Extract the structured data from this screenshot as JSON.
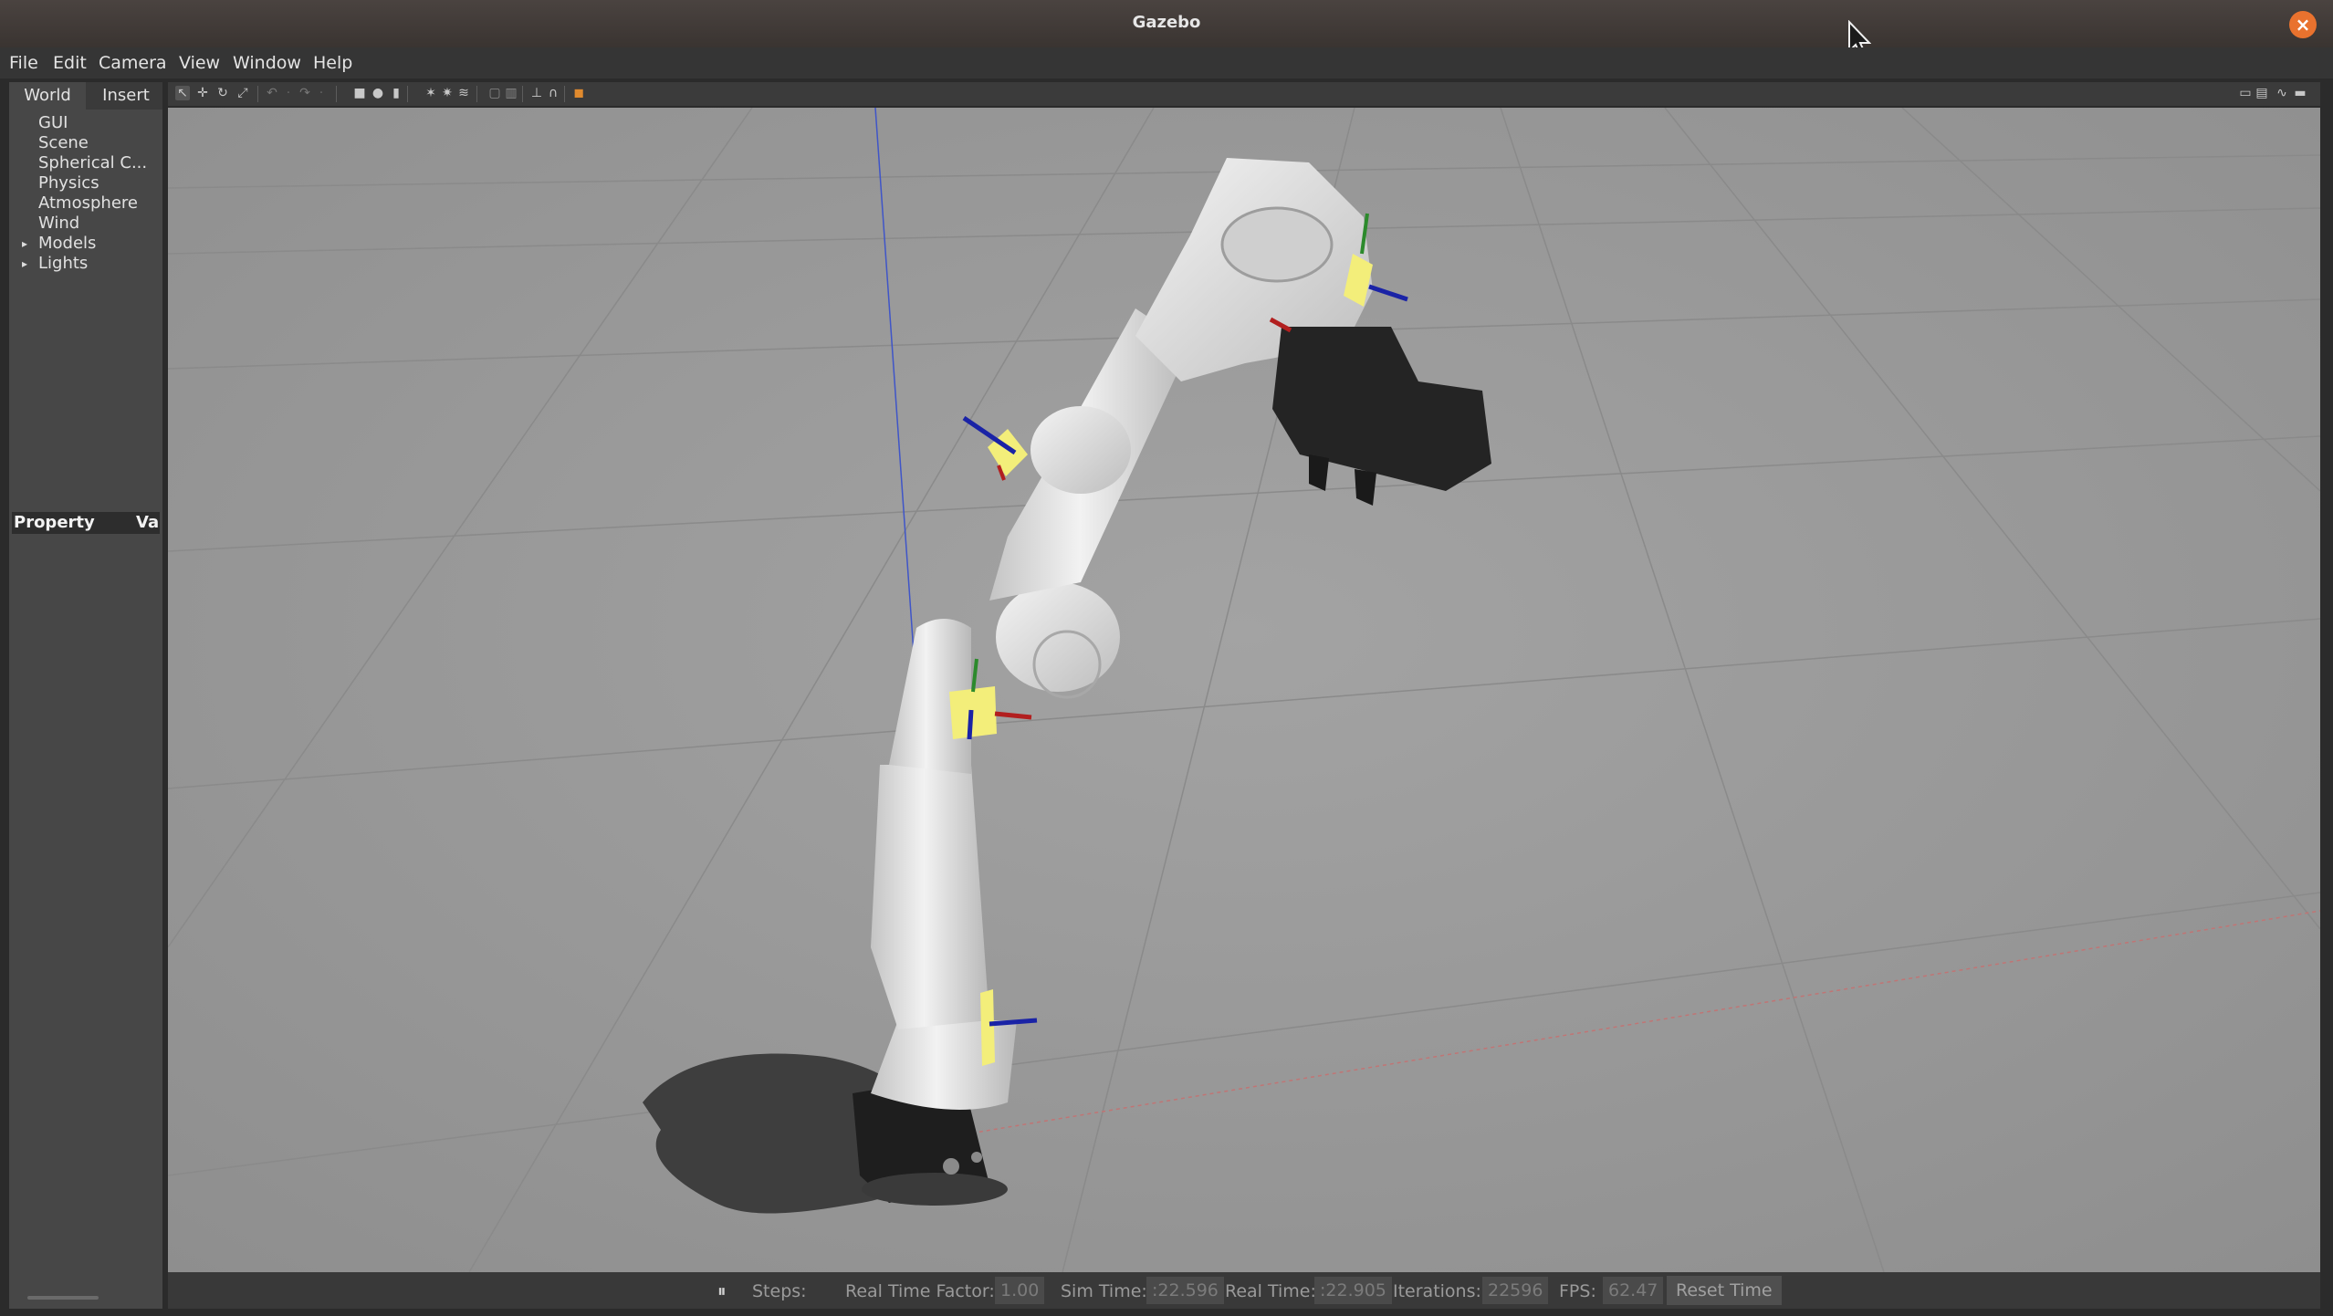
{
  "window": {
    "title": "Gazebo",
    "close_glyph": "×"
  },
  "menu": [
    "File",
    "Edit",
    "Camera",
    "View",
    "Window",
    "Help"
  ],
  "tabs": {
    "world": "World",
    "insert": "Insert"
  },
  "tree": {
    "gui": "GUI",
    "scene": "Scene",
    "spherical": "Spherical C...",
    "physics": "Physics",
    "atmosphere": "Atmosphere",
    "wind": "Wind",
    "models": "Models",
    "lights": "Lights"
  },
  "property_header": {
    "property": "Property",
    "value": "Va"
  },
  "toolbar_icons": [
    "select-arrow-icon",
    "translate-icon",
    "rotate-icon",
    "scale-icon",
    "undo-icon",
    "undo-history-icon",
    "redo-icon",
    "redo-history-icon",
    "box-icon",
    "sphere-icon",
    "cylinder-icon",
    "point-light-icon",
    "spot-light-icon",
    "directional-light-icon",
    "copy-icon",
    "paste-icon",
    "align-icon",
    "snap-icon",
    "change-view-icon",
    "screenshot-icon",
    "log-icon",
    "plot-icon",
    "video-icon"
  ],
  "status": {
    "pause_glyph": "⏸",
    "steps_label": "Steps:",
    "rtf_label": "Real Time Factor:",
    "rtf_value": "1.00",
    "sim_time_label": "Sim Time:",
    "sim_time_value": ":22.596",
    "real_time_label": "Real Time:",
    "real_time_value": ":22.905",
    "iterations_label": "Iterations:",
    "iterations_value": "22596",
    "fps_label": "FPS:",
    "fps_value": "62.47",
    "reset_label": "Reset Time"
  },
  "colors": {
    "close_button": "#e9722e",
    "viewport_bg": "#9a9a9a",
    "joint_marker": "#f3ee7a",
    "axis_x": "#b21f1f",
    "axis_y": "#2c8a2c",
    "axis_z": "#1a23a6",
    "robot_body": "#e6e6e6",
    "gripper": "#232323"
  }
}
